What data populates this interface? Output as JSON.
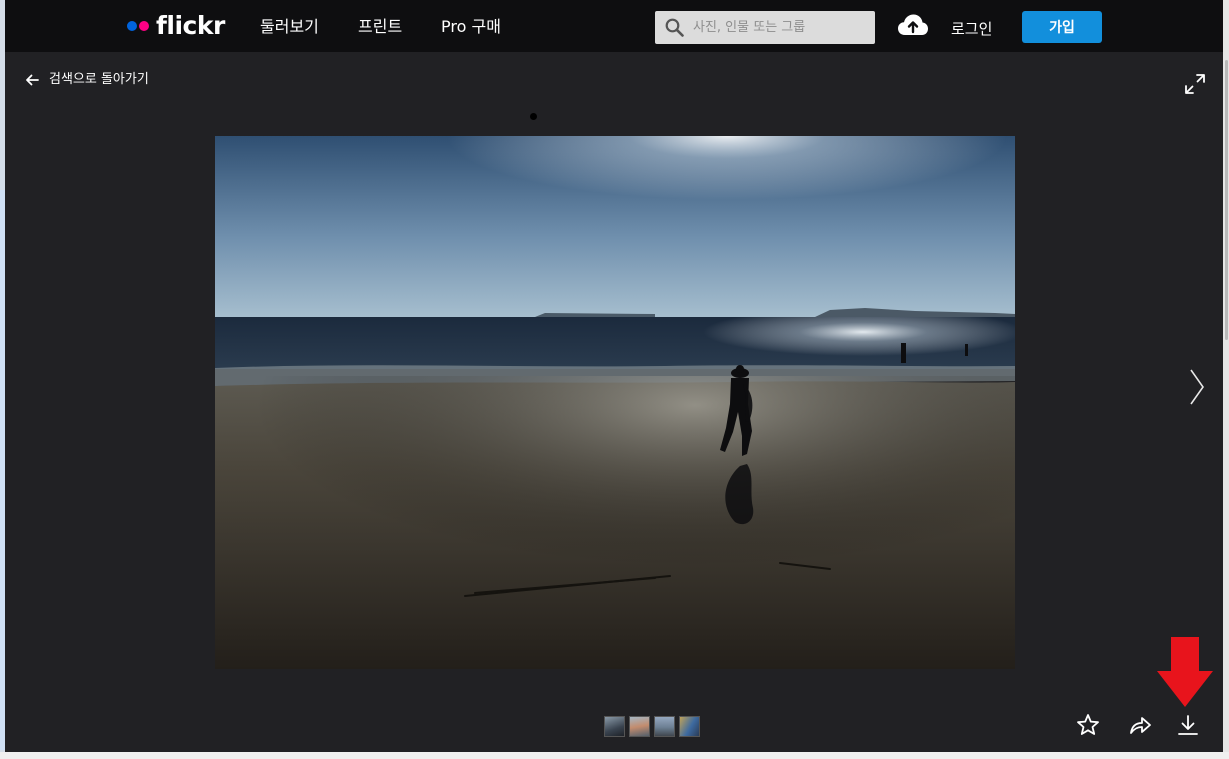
{
  "header": {
    "brand": "flickr",
    "nav": [
      "둘러보기",
      "프린트",
      "Pro 구매"
    ],
    "search_placeholder": "사진, 인물 또는 그룹",
    "login_label": "로그인",
    "signup_label": "가입"
  },
  "viewer": {
    "back_label": "검색으로 돌아가기"
  },
  "colors": {
    "topbar": "#0e0e10",
    "background": "#212124",
    "accent_blue": "#128fdc",
    "logo_blue": "#0063dc",
    "logo_pink": "#ff0084",
    "annotation_red": "#e8141c"
  },
  "icons": {
    "upload": "cloud-upload-icon",
    "back": "arrow-left-icon",
    "expand": "expand-icon",
    "next": "chevron-right-icon",
    "favorite": "star-icon",
    "share": "share-icon",
    "download": "download-icon",
    "annotation": "red-down-arrow-icon"
  }
}
